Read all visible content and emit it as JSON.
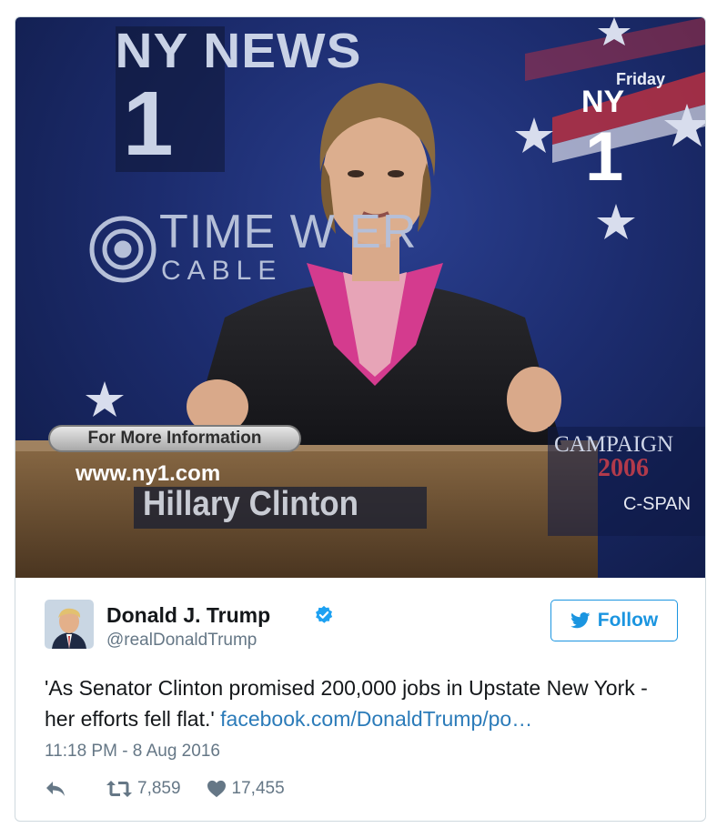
{
  "media": {
    "channel_logo": "NY NEWS",
    "channel_number": "1",
    "day": "Friday",
    "ny_corner": "NY",
    "one_corner": "1",
    "sponsor_partial": "TIME W    ER",
    "sponsor_sub": "CABLE",
    "info_label": "For More Information",
    "url": "www.ny1.com",
    "lower_third_name": "Hillary Clinton",
    "campaign_label": "CAMPAIGN",
    "campaign_year": "2006",
    "network": "C-SPAN"
  },
  "author": {
    "name": "Donald J. Trump",
    "handle": "@realDonaldTrump",
    "verified": true,
    "avatar_icon": "profile-avatar"
  },
  "follow_button": {
    "label": "Follow",
    "icon": "twitter-bird-icon"
  },
  "tweet": {
    "text": "'As Senator Clinton promised 200,000 jobs in Upstate New York - her efforts fell flat.'",
    "link_text": "facebook.com/DonaldTrump/po…",
    "timestamp": "11:18 PM - 8 Aug 2016"
  },
  "actions": {
    "reply_icon": "reply-icon",
    "retweet_icon": "retweet-icon",
    "retweet_count": "7,859",
    "like_icon": "heart-icon",
    "like_count": "17,455"
  },
  "colors": {
    "accent": "#1b95e0",
    "link": "#2b7bb9",
    "muted": "#657786",
    "text": "#14171a",
    "border": "#cfd9de"
  }
}
